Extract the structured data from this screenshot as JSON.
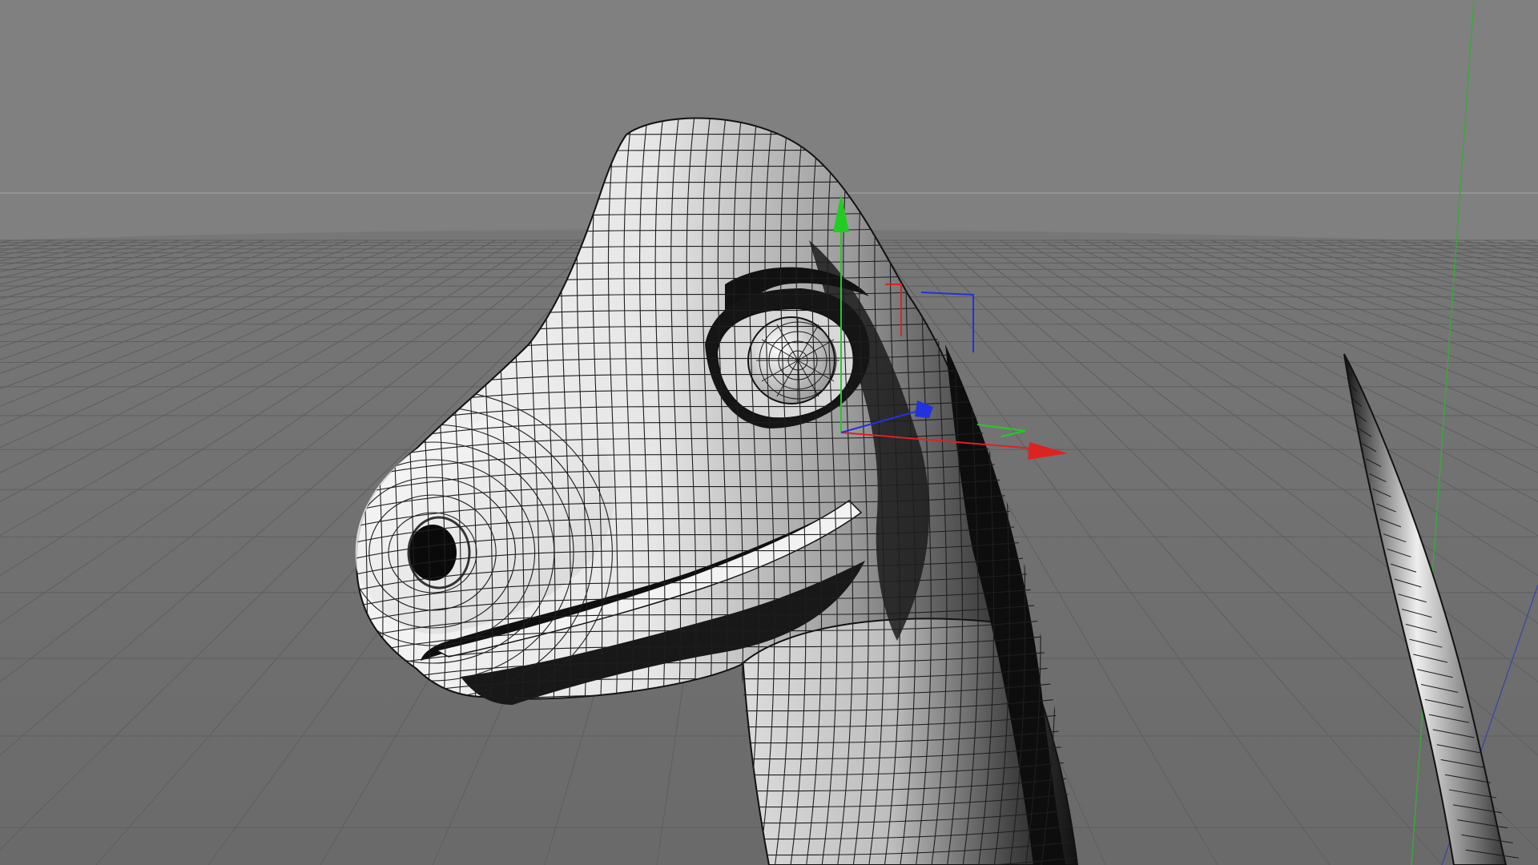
{
  "viewport": {
    "view": "perspective",
    "background_color": "#7f7f7f",
    "floor_color": "#6f6f6f",
    "grid_color": "#5b5b5b",
    "horizon_color": "#9a9a9a",
    "grid_visible": true
  },
  "model": {
    "object": "dinosaur-head-neck",
    "shading": "gouraud-with-wireframe-lines",
    "wire_color": "#1a1a1a"
  },
  "gizmo": {
    "tool": "move",
    "axes": [
      {
        "axis": "y",
        "color": "#22cc22"
      },
      {
        "axis": "x",
        "color": "#dd2222"
      },
      {
        "axis": "z",
        "color": "#2233dd"
      }
    ]
  },
  "world_axes": {
    "y_line_color": "#3aa83a"
  }
}
